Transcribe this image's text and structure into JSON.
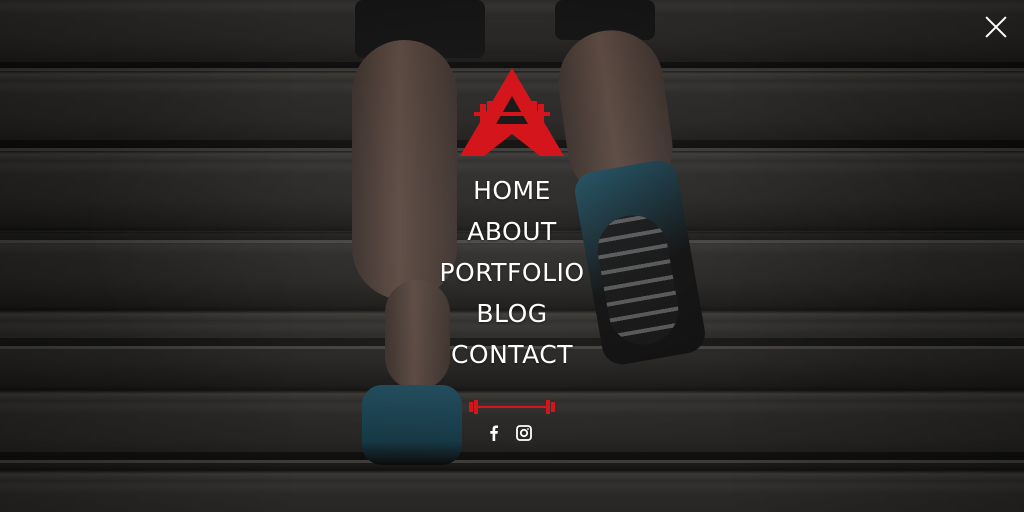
{
  "brand": {
    "accent_color": "#d4161c",
    "logo_icon": "barbell-triangle-logo"
  },
  "nav": {
    "items": [
      {
        "label": "HOME"
      },
      {
        "label": "ABOUT"
      },
      {
        "label": "PORTFOLIO"
      },
      {
        "label": "BLOG"
      },
      {
        "label": "CONTACT"
      }
    ]
  },
  "social": {
    "icons": [
      "facebook-icon",
      "instagram-icon"
    ]
  },
  "close": {
    "icon": "close-icon"
  }
}
